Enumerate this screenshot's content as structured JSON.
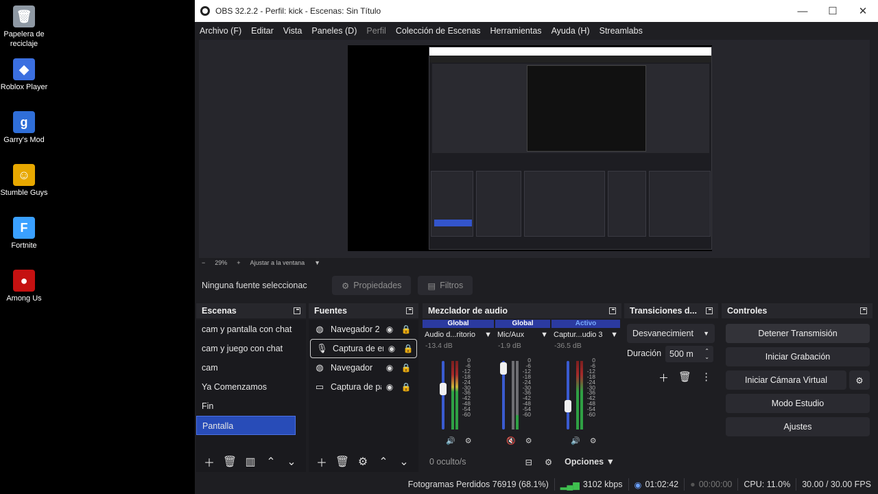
{
  "desktop": {
    "icons": [
      {
        "label": "Papelera de reciclaje",
        "icon": "recycle-bin-icon",
        "color": "#9aa3ad"
      },
      {
        "label": "Roblox Player",
        "icon": "roblox-icon",
        "color": "#3b6fe0"
      },
      {
        "label": "Garry's Mod",
        "icon": "garrys-mod-icon",
        "color": "#2f6ed8"
      },
      {
        "label": "Stumble Guys",
        "icon": "stumble-guys-icon",
        "color": "#f0b400"
      },
      {
        "label": "Fortnite",
        "icon": "fortnite-icon",
        "color": "#3aa0ff"
      },
      {
        "label": "Among Us",
        "icon": "among-us-icon",
        "color": "#c51111"
      }
    ]
  },
  "window": {
    "title": "OBS 32.2.2 - Perfil: kick - Escenas: Sin Título",
    "minimize": "—",
    "maximize": "☐",
    "close": "✕"
  },
  "menu": [
    "Archivo (F)",
    "Editar",
    "Vista",
    "Paneles (D)",
    "Perfil",
    "Colección de Escenas",
    "Herramientas",
    "Ayuda (H)",
    "Streamlabs"
  ],
  "zoom": {
    "minus": "−",
    "value": "29%",
    "plus": "+",
    "fit": "Ajustar a la ventana"
  },
  "source_bar": {
    "no_source": "Ninguna fuente seleccionac",
    "properties": "Propiedades",
    "filters": "Filtros"
  },
  "scenes": {
    "title": "Escenas",
    "items": [
      "cam y pantalla con chat",
      "cam y juego con chat",
      "cam",
      "Ya Comenzamos",
      "Fin",
      "Pantalla"
    ],
    "active_index": 5
  },
  "sources": {
    "title": "Fuentes",
    "items": [
      {
        "name": "Navegador 2",
        "icon": "globe-icon"
      },
      {
        "name": "Captura de en",
        "icon": "microphone-icon"
      },
      {
        "name": "Navegador",
        "icon": "globe-icon"
      },
      {
        "name": "Captura de pa",
        "icon": "monitor-icon"
      }
    ]
  },
  "mixer": {
    "title": "Mezclador de audio",
    "channels": [
      {
        "tag": "Global",
        "name": "Audio d...ritorio",
        "db": "-13.4 dB",
        "level": 0.62
      },
      {
        "tag": "Global",
        "name": "Mic/Aux",
        "db": "-1.9 dB",
        "level": 0.98
      },
      {
        "tag": "Activo",
        "name": "Captur...udio 3",
        "db": "-36.5 dB",
        "level": 0.35
      }
    ],
    "scale": [
      "0",
      "-6",
      "-12",
      "-18",
      "-24",
      "-30",
      "-36",
      "-42",
      "-48",
      "-54",
      "-60"
    ],
    "hidden": "0 oculto/s",
    "options": "Opciones"
  },
  "transitions": {
    "title": "Transiciones d...",
    "type": "Desvanecimient",
    "duration_label": "Duración",
    "duration_value": "500 m"
  },
  "controls": {
    "title": "Controles",
    "stop_stream": "Detener Transmisión",
    "start_record": "Iniciar Grabación",
    "virtual_cam": "Iniciar Cámara Virtual",
    "studio_mode": "Modo Estudio",
    "settings": "Ajustes"
  },
  "status": {
    "dropped": "Fotogramas Perdidos 76919 (68.1%)",
    "bitrate": "3102 kbps",
    "stream_time": "01:02:42",
    "record_time": "00:00:00",
    "cpu": "CPU: 11.0%",
    "fps": "30.00 / 30.00 FPS"
  }
}
